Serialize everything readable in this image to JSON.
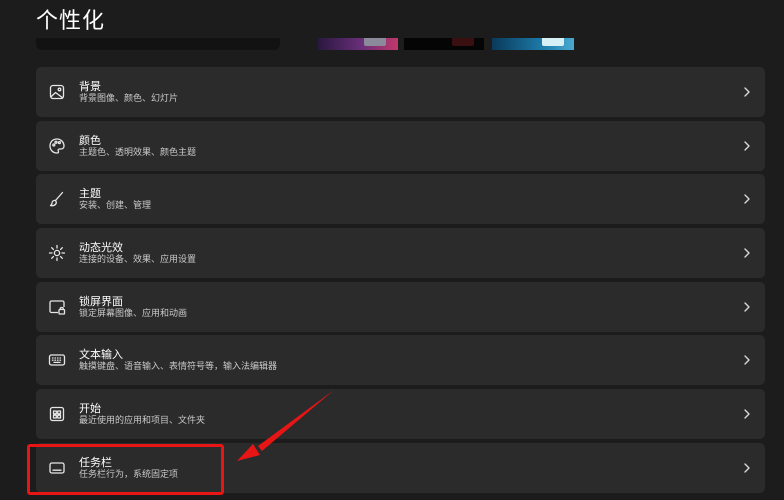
{
  "page": {
    "title": "个性化"
  },
  "settings": [
    {
      "icon": "picture-icon",
      "title": "背景",
      "description": "背景图像、颜色、幻灯片"
    },
    {
      "icon": "palette-icon",
      "title": "颜色",
      "description": "主题色、透明效果、颜色主题"
    },
    {
      "icon": "brush-icon",
      "title": "主题",
      "description": "安装、创建、管理"
    },
    {
      "icon": "dynamic-lighting-icon",
      "title": "动态光效",
      "description": "连接的设备、效果、应用设置"
    },
    {
      "icon": "lock-screen-icon",
      "title": "锁屏界面",
      "description": "锁定屏幕图像、应用和动画"
    },
    {
      "icon": "keyboard-icon",
      "title": "文本输入",
      "description": "触摸键盘、语音输入、表情符号等，输入法编辑器"
    },
    {
      "icon": "start-menu-icon",
      "title": "开始",
      "description": "最近使用的应用和项目、文件夹"
    },
    {
      "icon": "taskbar-icon",
      "title": "任务栏",
      "description": "任务栏行为，系统固定项"
    }
  ],
  "annotation": {
    "color": "#e81515",
    "target": "任务栏"
  }
}
